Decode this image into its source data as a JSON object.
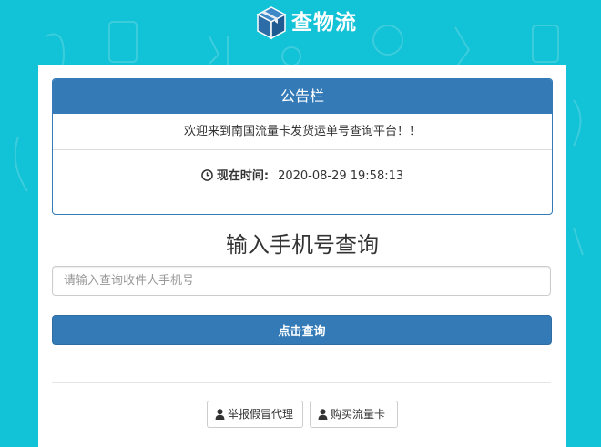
{
  "header": {
    "brand": "查物流",
    "logo_icon": "package-box-icon"
  },
  "notice": {
    "title": "公告栏",
    "message": "欢迎来到南国流量卡发货运单号查询平台！！",
    "time_icon": "clock-icon",
    "time_label": "现在时间:",
    "time_value": "2020-08-29 19:58:13"
  },
  "query": {
    "title": "输入手机号查询",
    "input_placeholder": "请输入查询收件人手机号",
    "input_value": "",
    "button_label": "点击查询"
  },
  "footer_links": {
    "report_label": "举报假冒代理",
    "buy_label": "购买流量卡",
    "icon": "user-icon"
  },
  "colors": {
    "background": "#12c2d6",
    "primary": "#337ab7",
    "card": "#ffffff"
  }
}
